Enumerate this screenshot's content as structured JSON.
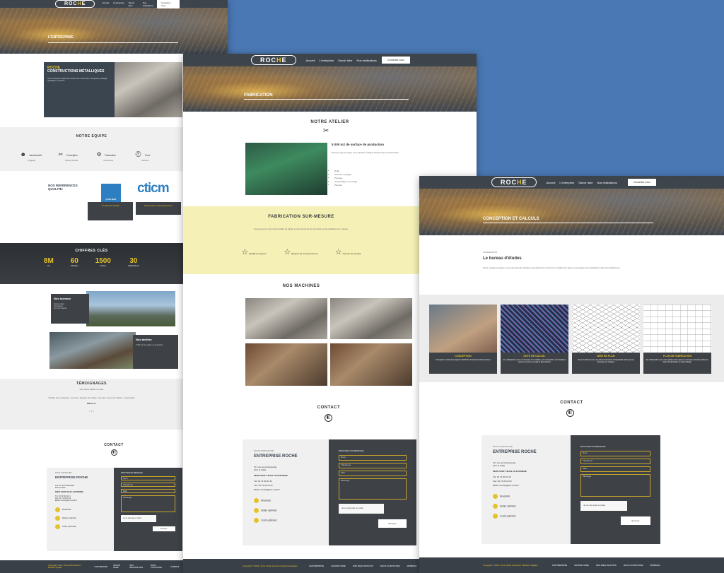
{
  "brand": {
    "logo_pre": "ROC",
    "logo_h": "H",
    "logo_post": "E"
  },
  "nav": {
    "items": [
      "Accueil",
      "L'entreprise",
      "Savoir faire",
      "Nos réalisations"
    ],
    "cta": "Contactez nous"
  },
  "page1": {
    "hero_title": "L'ENTREPRISE",
    "intro_title_1": "ROCHE",
    "intro_title_2": "CONSTRUCTIONS MÉTALLIQUES",
    "intro_text": "Notre entreprise réalise des travaux de construction, charpentes, bardage, métallique, serrurerie.",
    "team_title": "NOTRE EQUIPE",
    "team": [
      {
        "label": "Administratif",
        "desc": "1 dirigeant"
      },
      {
        "label": "Conception",
        "desc": "Bureau d'études"
      },
      {
        "label": "Fabrication",
        "desc": "8 personnes"
      },
      {
        "label": "Pose",
        "desc": "Monteurs"
      }
    ],
    "ref_title": "NOS RÉFÉRENCES QUALITÉ:",
    "qualibat_label": "QUALIBAT",
    "qualibat_caption": "Un label de qualité",
    "cticm_label": "cticm",
    "cticm_caption": "Recherche et Développement",
    "keyfig_title": "CHIFFRES CLÉS",
    "keyfigs": [
      {
        "value": "8M",
        "label": "CA"
      },
      {
        "value": "60",
        "label": "Chantiers"
      },
      {
        "value": "1500",
        "label": "Tonnes"
      },
      {
        "value": "30",
        "label": "Collaborateurs"
      }
    ],
    "bureaux_title": "Nos bureaux",
    "bureaux_items": [
      "Etudes projet",
      "Conception",
      "Suivi de chantier"
    ],
    "ateliers_title": "Nos ateliers",
    "ateliers_text": "5 000 m2 de surface de production",
    "testimonials_title": "TÉMOIGNAGES",
    "testimonials_sub": "Nos clients parlent de nous",
    "quote": "\"Qualité de la réalisation : très bien. Respect des délais : très bien. Tenue du chantier : impeccable\"",
    "quote_author": "Patrice G.",
    "contact_title": "CONTACT"
  },
  "page2": {
    "hero_title": "FABRICATION",
    "atelier_title": "NOTRE ATELIER",
    "atelier_sub": "5 000 m2 de surface de production",
    "atelier_text": "Tout au long du projet nous étudions chaque élément de la construction.",
    "atelier_list": [
      "Débit",
      "Soudure et pliage",
      "Perçage",
      "Assemblage et montage",
      "Peinture"
    ],
    "surmesure_title": "FABRICATION SUR-MESURE",
    "surmesure_text": "Nous pouvons créer des profilés de pliage et des éléments de serrurerie et de métallerie sur mesure.",
    "values": [
      "Qualité des pièces",
      "Respect de l'environnement",
      "Normes de sécurité"
    ],
    "machines_title": "NOS MACHINES",
    "contact_title": "CONTACT"
  },
  "page3": {
    "hero_title": "CONCEPTION ET CALCULS",
    "kicker": "CONCEPTION",
    "bureau_title": "Le bureau d'études",
    "bureau_text": "Notre société possède son propre bureau d'études permettant de concevoir et réaliser les pièces nécessaires à la réalisation des futurs bâtiments.",
    "steps": [
      {
        "title": "CONCEPTION",
        "desc": "Conception à l'aide des logiciels CAD/CAO, Autocad et Advance Steel."
      },
      {
        "title": "NOTE DE CALCUL",
        "desc": "En collaboration avec nos bureaux de contrôles, nos conceptions sont réalisées selon les normes en vigueur (Eurocodes)."
      },
      {
        "title": "MISE EN PLAN",
        "desc": "Nous fournissons tous les plans d'exécution d'implantation ainsi que les descentes de charges."
      },
      {
        "title": "PLAN DE FABRICATION",
        "desc": "En collaboration avec notre atelier et les poseurs, le bureau d'études réalise les plans de fabrication et d'assemblage."
      }
    ],
    "contact_title": "CONTACT"
  },
  "contact": {
    "kicker": "NOUS CONTACTER",
    "company": "ENTREPRISE ROCHE",
    "address_1": "271 rue de la Passerelle",
    "address_2": "ZAC la Vialle",
    "city": "69350 SAINT JEAN LE BUSSIERE",
    "tel": "Tél: 04 74 80 22 44",
    "fax": "Fax: 04 74 05 29 22",
    "email": "EMail: contact@ent-roche.fr",
    "form_title": "ENVOYER UN MESSAGE",
    "fields": [
      "Nom",
      "Téléphone",
      "Mail",
      "Message"
    ],
    "recaptcha": "Je ne suis pas un robot",
    "submit": "Envoyer",
    "perks": [
      "Réactivité",
      "Délais maîtrisés",
      "Coûts optimisés"
    ]
  },
  "footer": {
    "copyright": "Copyright © 2021 | Tous droits réservés | Mentions légales",
    "links": [
      "L'ENTREPRISE",
      "SAVOIR FAIRE",
      "NOS RÉALISATIONS",
      "NOUS CONTACTER",
      "MOBIRAIL"
    ]
  }
}
